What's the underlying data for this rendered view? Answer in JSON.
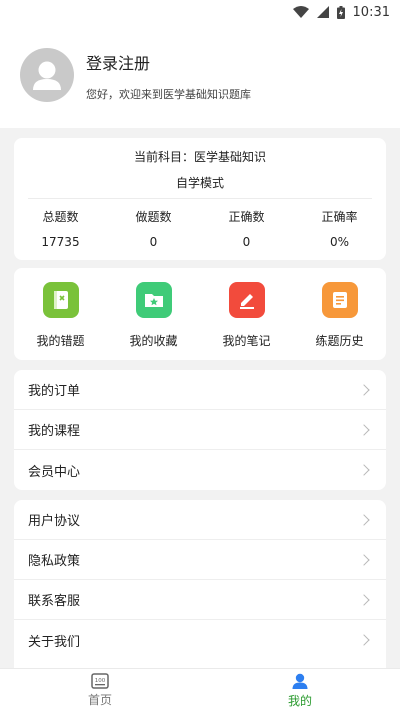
{
  "status": {
    "time": "10:31"
  },
  "profile": {
    "name": "登录注册",
    "subtitle": "您好，欢迎来到医学基础知识题库"
  },
  "stats": {
    "subject_line": "当前科目：医学基础知识",
    "mode": "自学模式",
    "headers": [
      "总题数",
      "做题数",
      "正确数",
      "正确率"
    ],
    "values": [
      "17735",
      "0",
      "0",
      "0%"
    ]
  },
  "features": [
    {
      "label": "我的错题",
      "icon": "wrong-book-icon",
      "color": "#7ac23a"
    },
    {
      "label": "我的收藏",
      "icon": "favorite-folder-icon",
      "color": "#3fcb78"
    },
    {
      "label": "我的笔记",
      "icon": "note-pen-icon",
      "color": "#f24b3c"
    },
    {
      "label": "练题历史",
      "icon": "history-list-icon",
      "color": "#f7983a"
    }
  ],
  "menu_group_1": [
    {
      "label": "我的订单"
    },
    {
      "label": "我的课程"
    },
    {
      "label": "会员中心"
    }
  ],
  "menu_group_2": [
    {
      "label": "用户协议"
    },
    {
      "label": "隐私政策"
    },
    {
      "label": "联系客服"
    },
    {
      "label": "关于我们"
    }
  ],
  "bottom_nav": {
    "home": "首页",
    "mine": "我的",
    "active_color": "#2a9a2e",
    "inactive_color": "#777777"
  }
}
